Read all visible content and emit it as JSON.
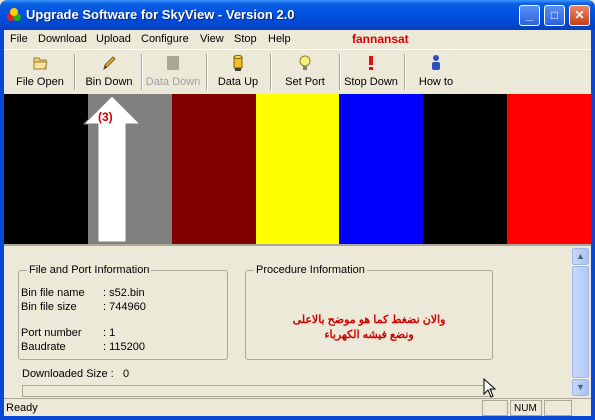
{
  "window": {
    "title": "Upgrade Software for SkyView - Version 2.0"
  },
  "title_buttons": {
    "minimize": "_",
    "maximize": "□",
    "close": "✕"
  },
  "menu": [
    "File",
    "Download",
    "Upload",
    "Configure",
    "View",
    "Stop",
    "Help"
  ],
  "brand": "fannansat",
  "toolbar": {
    "file_open": "File Open",
    "bin_down": "Bin Down",
    "data_down": "Data Down",
    "data_up": "Data Up",
    "set_port": "Set Port",
    "stop_down": "Stop Down",
    "how_to": "How to"
  },
  "color_bars": [
    "#000000",
    "#808080",
    "#800000",
    "#ffff00",
    "#0000ff",
    "#000000",
    "#ff0000"
  ],
  "annotation": {
    "label": "(3)"
  },
  "file_port": {
    "title": "File and Port Information",
    "bin_file_name_label": "Bin file name",
    "bin_file_name_value": ": s52.bin",
    "bin_file_size_label": "Bin file size",
    "bin_file_size_value": ": 744960",
    "port_number_label": "Port number",
    "port_number_value": ": 1",
    "baudrate_label": "Baudrate",
    "baudrate_value": ": 115200"
  },
  "procedure": {
    "title": "Procedure Information",
    "line1": "والان نضغط كما هو موضح بالاعلى",
    "line2": "ونضع فيشه الكهرباء"
  },
  "downloaded": {
    "label": "Downloaded Size :",
    "value": "0",
    "progress": 0
  },
  "status": {
    "text": "Ready",
    "num": "NUM"
  },
  "icons": {
    "file_open": "folder-open-icon",
    "bin_down": "pencil-icon",
    "data_down": "gray-box-icon",
    "data_up": "yellow-cylinder-icon",
    "set_port": "lightbulb-icon",
    "stop_down": "red-exclamation-icon",
    "how_to": "person-icon"
  }
}
